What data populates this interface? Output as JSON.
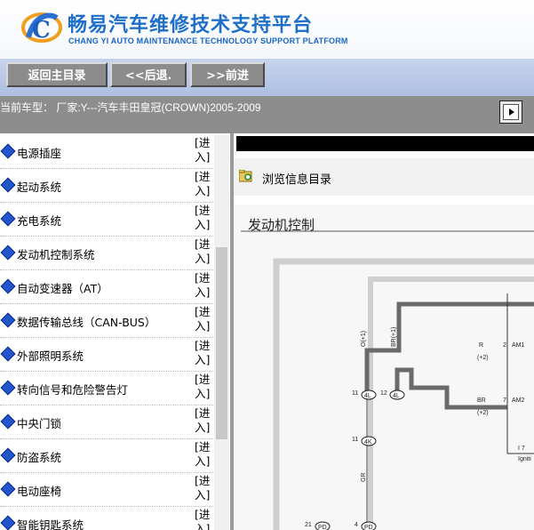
{
  "header": {
    "title_cn": "畅易汽车维修技术支持平台",
    "title_en": "CHANG YI AUTO MAINTENANCE TECHNOLOGY SUPPORT PLATFORM",
    "logo_icon": "cy-logo-icon"
  },
  "nav": {
    "home_label": "返回主目录",
    "back_label": "<<后退.",
    "forward_label": ">>前进"
  },
  "model": {
    "text": "当前车型：  厂家:Y---汽车丰田皇冠(CROWN)2005-2009"
  },
  "list": {
    "enter_label": "[进入]",
    "items": [
      {
        "label": "电源插座"
      },
      {
        "label": "起动系统"
      },
      {
        "label": "充电系统"
      },
      {
        "label": "发动机控制系统"
      },
      {
        "label": "自动变速器（AT）"
      },
      {
        "label": "数据传输总线（CAN-BUS）"
      },
      {
        "label": "外部照明系统"
      },
      {
        "label": "转向信号和危险警告灯"
      },
      {
        "label": "中央门锁"
      },
      {
        "label": "防盗系统"
      },
      {
        "label": "电动座椅"
      },
      {
        "label": "智能钥匙系统"
      }
    ]
  },
  "right": {
    "browse_label": "浏览信息目录",
    "diagram_title": "发动机控制",
    "diagram_labels": {
      "o1": "O(+1)",
      "br1": "BR(+1)",
      "r": "R",
      "r_pin": "2",
      "am1": "AM1",
      "plus2a": "(+2)",
      "br": "BR",
      "br_pin": "7",
      "am2": "AM2",
      "plus2b": "(+2)",
      "n11a": "11",
      "n12": "12",
      "c4l_a": "4L",
      "c4l_b": "4L",
      "n11b": "11",
      "c4k": "4K",
      "gr": "GR",
      "i7": "I 7",
      "ignit": "Igniti",
      "n21": "21",
      "pd1": "PD",
      "n4": "4",
      "pd2": "PD"
    }
  }
}
